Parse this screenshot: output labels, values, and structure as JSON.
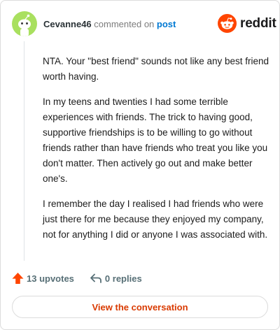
{
  "header": {
    "username": "Cevanne46",
    "action_text": "commented on",
    "post_link": "post",
    "brand": "reddit"
  },
  "comment": {
    "paragraphs": [
      "NTA. Your \"best friend\" sounds not like any best friend worth having.",
      "In my teens and twenties I had some terrible experiences with friends. The trick to having good, supportive friendships is to be willing to go without friends rather than have friends who treat you like you don't matter. Then actively go out and make better one's.",
      "I remember the day I realised I had friends who were just there for me because they enjoyed my company, not for anything I did or anyone I was associated with."
    ]
  },
  "actions": {
    "upvotes": "13 upvotes",
    "replies": "0 replies"
  },
  "cta": {
    "label": "View the conversation"
  },
  "colors": {
    "accent_orange": "#ff4500",
    "cta_text": "#d93a00",
    "link_blue": "#0079d3",
    "avatar_bg": "#a9e05f"
  },
  "icons": {
    "avatar": "snoo-avatar-icon",
    "logo": "reddit-alien-icon",
    "upvote": "upvote-arrow-icon",
    "reply": "reply-arrow-icon"
  }
}
